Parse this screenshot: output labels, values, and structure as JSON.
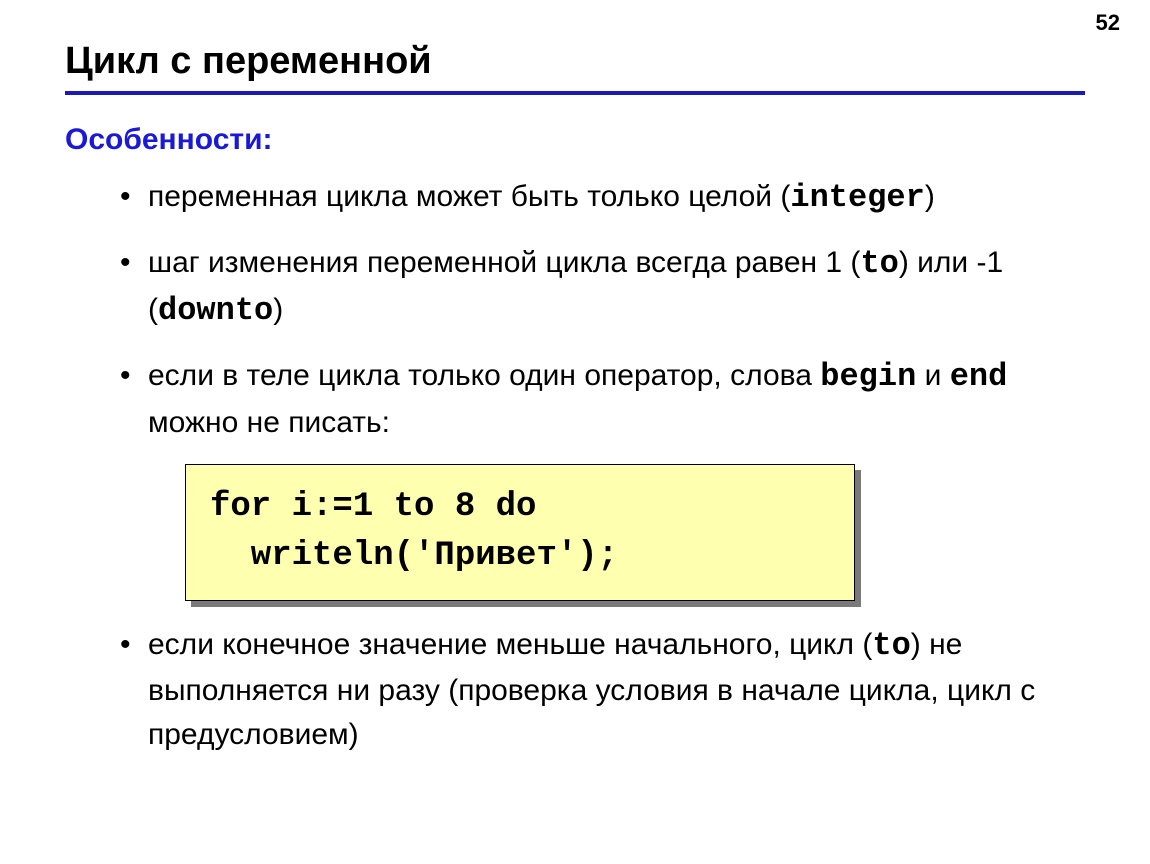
{
  "pageNumber": "52",
  "title": "Цикл с переменной",
  "subhead": "Особенности:",
  "bullets": {
    "b1": {
      "t1": "переменная цикла может быть только целой (",
      "kw1": "integer",
      "t2": ")"
    },
    "b2": {
      "t1": "шаг изменения переменной цикла всегда равен 1 (",
      "kw1": "to",
      "t2": ") или -1 (",
      "kw2": "downto",
      "t3": ")"
    },
    "b3": {
      "t1": "если в теле цикла только один оператор, слова ",
      "kw1": "begin",
      "t2": " и ",
      "kw2": "end",
      "t3": " можно не писать:"
    },
    "b4": {
      "t1": "если конечное значение меньше начального, цикл (",
      "kw1": "to",
      "t2": ") не выполняется ни разу (проверка условия в начале цикла, цикл с предусловием)"
    }
  },
  "code": "for i:=1 to 8 do\n  writeln('Привет');"
}
